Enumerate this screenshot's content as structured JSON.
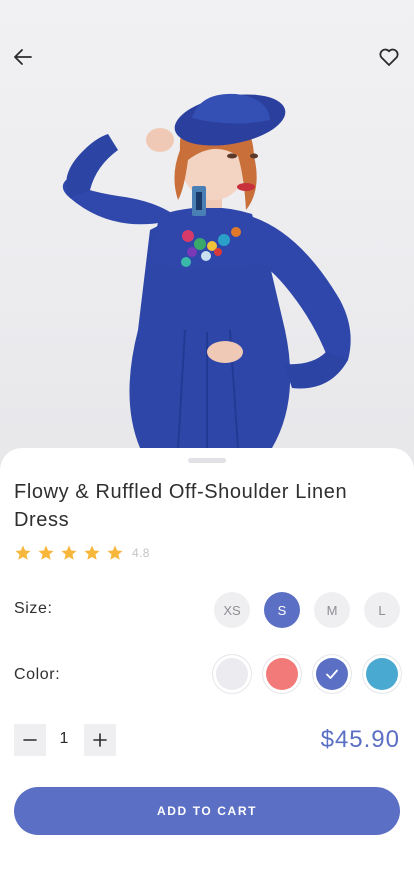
{
  "header": {
    "back_icon": "arrow-left-icon",
    "favorite_icon": "heart-outline-icon"
  },
  "product": {
    "image": "woman in blue dress and hat",
    "title": "Flowy & Ruffled Off-Shoulder Linen Dress",
    "rating": 4.8,
    "rating_label": "4.8",
    "stars_filled": 5
  },
  "size": {
    "label": "Size:",
    "options": [
      "XS",
      "S",
      "M",
      "L"
    ],
    "selected": "S"
  },
  "color": {
    "label": "Color:",
    "options": [
      "#ebebf0",
      "#f27a78",
      "#5b6fc4",
      "#4aa9d0"
    ],
    "selected": "#5b6fc4"
  },
  "quantity": {
    "value": "1",
    "minus_icon": "minus-icon",
    "plus_icon": "plus-icon"
  },
  "price": "$45.90",
  "cart_button": "ADD TO CART",
  "colors": {
    "accent": "#5b6fc4",
    "star": "#f6b73c"
  }
}
